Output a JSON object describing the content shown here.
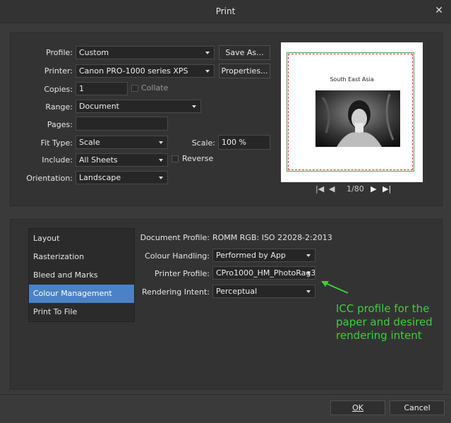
{
  "window": {
    "title": "Print",
    "close": "✕"
  },
  "form": {
    "profile": {
      "label": "Profile:",
      "value": "Custom"
    },
    "printer": {
      "label": "Printer:",
      "value": "Canon PRO-1000 series XPS"
    },
    "copies": {
      "label": "Copies:",
      "value": "1"
    },
    "collate_label": "Collate",
    "range": {
      "label": "Range:",
      "value": "Document"
    },
    "pages": {
      "label": "Pages:",
      "value": ""
    },
    "fit_type": {
      "label": "Fit Type:",
      "value": "Scale"
    },
    "scale": {
      "label": "Scale:",
      "value": "100 %"
    },
    "include": {
      "label": "Include:",
      "value": "All Sheets"
    },
    "reverse_label": "Reverse",
    "orientation": {
      "label": "Orientation:",
      "value": "Landscape"
    },
    "save_as_label": "Save As...",
    "properties_label": "Properties..."
  },
  "preview": {
    "title": "South East Asia",
    "page_indicator": "1/80"
  },
  "sidebar": {
    "items": [
      {
        "label": "Layout"
      },
      {
        "label": "Rasterization"
      },
      {
        "label": "Bleed and Marks"
      },
      {
        "label": "Colour Management"
      },
      {
        "label": "Print To File"
      }
    ],
    "active_index": 3
  },
  "colour_management": {
    "document_profile": {
      "label": "Document Profile:",
      "value": "ROMM RGB: ISO 22028-2:2013"
    },
    "colour_handling": {
      "label": "Colour Handling:",
      "value": "Performed by App"
    },
    "printer_profile": {
      "label": "Printer Profile:",
      "value": "CPro1000_HM_PhotoRag3"
    },
    "rendering_intent": {
      "label": "Rendering Intent:",
      "value": "Perceptual"
    }
  },
  "annotation": {
    "text": "ICC profile for the paper and desired rendering intent"
  },
  "footer": {
    "ok_label": "OK",
    "cancel_label": "Cancel"
  },
  "colors": {
    "accent": "#4a82c4",
    "annotation": "#3ecf3e"
  }
}
